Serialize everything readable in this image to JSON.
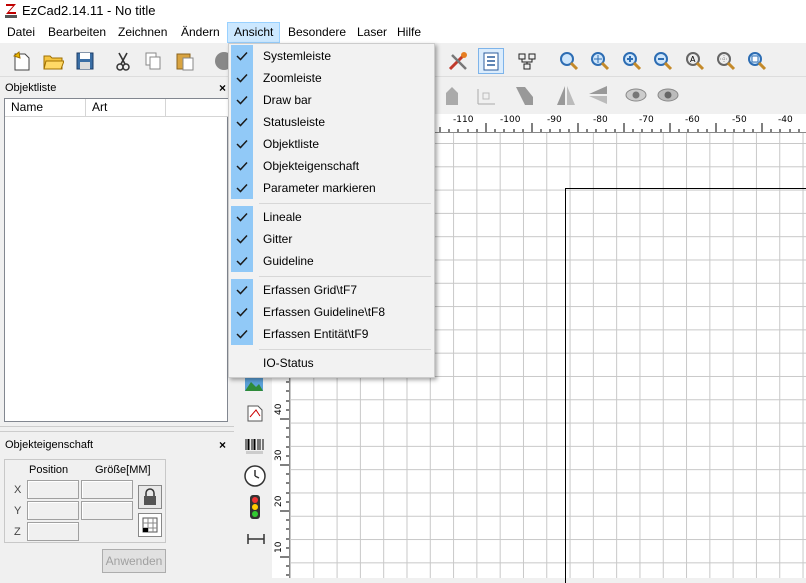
{
  "window": {
    "title": "EzCad2.14.11 - No title"
  },
  "menubar": [
    {
      "label": "Datei"
    },
    {
      "label": "Bearbeiten"
    },
    {
      "label": "Zeichnen"
    },
    {
      "label": "Ändern"
    },
    {
      "label": "Ansicht"
    },
    {
      "label": "Besondere"
    },
    {
      "label": "Laser"
    },
    {
      "label": "Hilfe"
    }
  ],
  "view_menu": {
    "items": [
      {
        "label": "Systemleiste",
        "checked": true
      },
      {
        "label": "Zoomleiste",
        "checked": true
      },
      {
        "label": "Draw bar",
        "checked": true
      },
      {
        "label": "Statusleiste",
        "checked": true
      },
      {
        "label": "Objektliste",
        "checked": true
      },
      {
        "label": "Objekteigenschaft",
        "checked": true
      },
      {
        "label": "Parameter markieren",
        "checked": true
      },
      {
        "label": "Lineale",
        "checked": true
      },
      {
        "label": "Gitter",
        "checked": true
      },
      {
        "label": "Guideline",
        "checked": true
      },
      {
        "label": "Erfassen Grid\\tF7",
        "checked": true
      },
      {
        "label": "Erfassen Guideline\\tF8",
        "checked": true
      },
      {
        "label": "Erfassen Entität\\tF9",
        "checked": true
      },
      {
        "label": "IO-Status",
        "checked": false
      }
    ]
  },
  "object_list": {
    "title": "Objektliste",
    "close": "×",
    "columns": [
      "Name",
      "Art"
    ]
  },
  "object_props": {
    "title": "Objekteigenschaft",
    "close": "×",
    "position_label": "Position",
    "size_label": "Größe[MM]",
    "axes": [
      "X",
      "Y",
      "Z"
    ],
    "apply_label": "Anwenden"
  },
  "ruler": {
    "top": [
      "-110",
      "-100",
      "-90",
      "-80",
      "-70",
      "-60",
      "-50",
      "-40"
    ],
    "left": [
      "40",
      "30",
      "20",
      "10"
    ]
  },
  "colors": {
    "accent_check": "#91c9f7",
    "menu_active": "#cce8ff",
    "grid": "#c8c8c8"
  }
}
